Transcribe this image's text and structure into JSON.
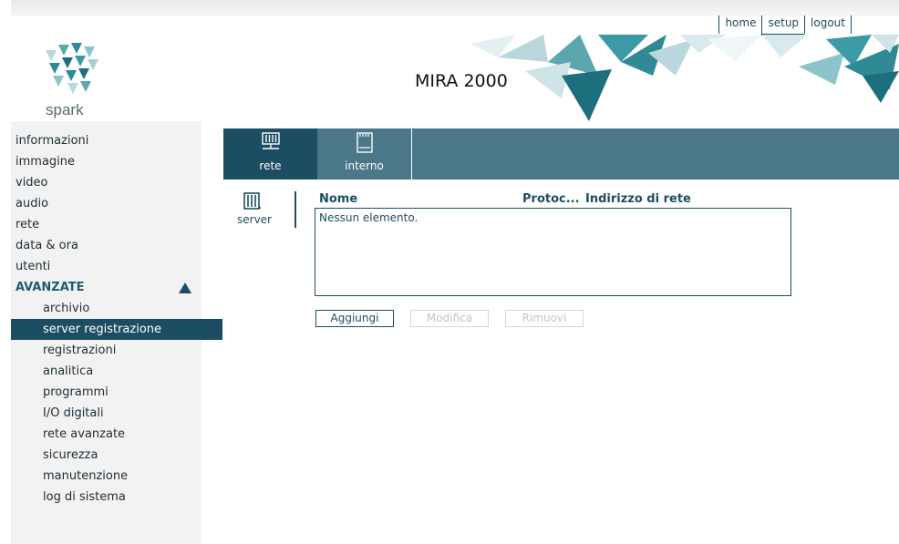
{
  "top_links": [
    "home",
    "setup",
    "logout"
  ],
  "header": {
    "logo_text": "spark",
    "title": "MIRA 2000"
  },
  "sidebar": {
    "items": [
      "informazioni",
      "immagine",
      "video",
      "audio",
      "rete",
      "data & ora",
      "utenti"
    ],
    "group": "AVANZATE",
    "sub_items": [
      "archivio",
      "server registrazione",
      "registrazioni",
      "analitica",
      "programmi",
      "I/O digitali",
      "rete avanzate",
      "sicurezza",
      "manutenzione",
      "log di sistema"
    ],
    "active_sub": "server registrazione"
  },
  "tabs": [
    {
      "label": "rete"
    },
    {
      "label": "interno"
    }
  ],
  "subnav": {
    "label": "server"
  },
  "table": {
    "columns": [
      "Nome",
      "Protoc...",
      "Indirizzo di rete"
    ],
    "empty_text": "Nessun elemento."
  },
  "buttons": {
    "add": "Aggiungi",
    "edit": "Modifica",
    "remove": "Rimuovi"
  },
  "colors": {
    "accent": "#1d4d63",
    "tabbar": "#4a7889",
    "sidebar_bg": "#f2f2f2"
  }
}
